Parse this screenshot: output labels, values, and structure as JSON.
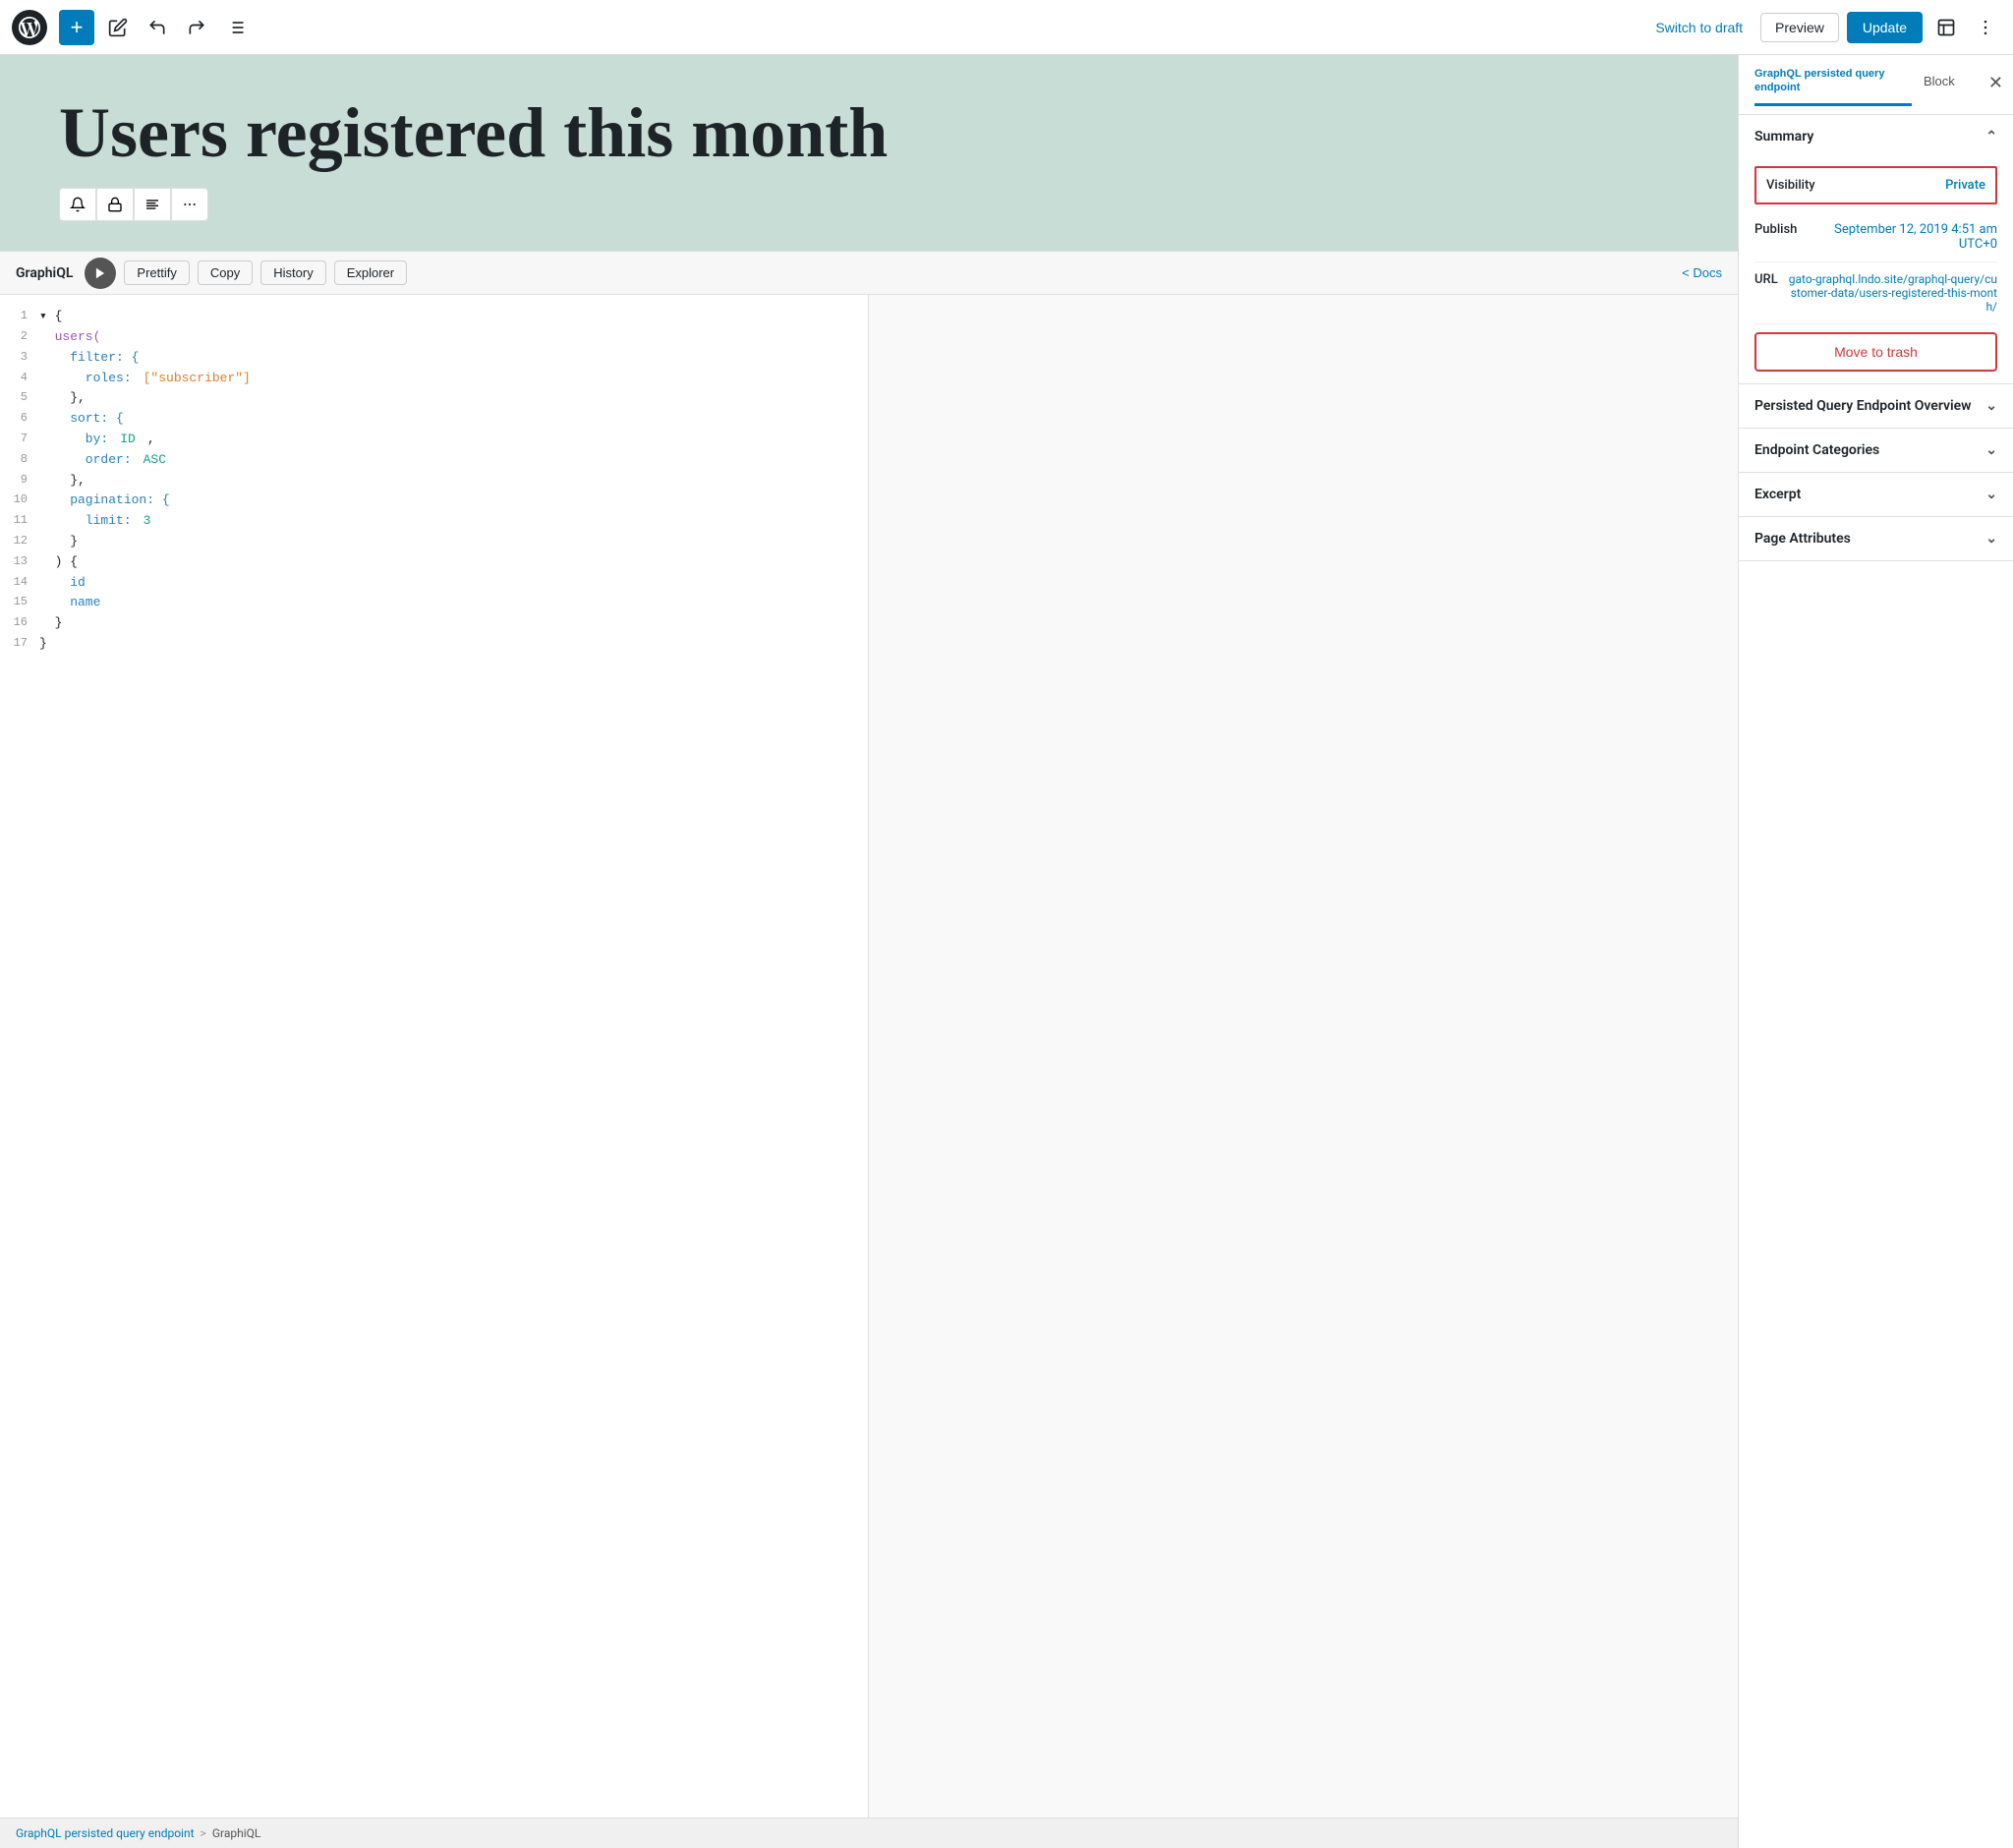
{
  "toolbar": {
    "plus_label": "+",
    "switch_to_draft_label": "Switch to draft",
    "preview_label": "Preview",
    "update_label": "Update"
  },
  "hero": {
    "title": "Users registered this month"
  },
  "graphiql": {
    "title": "GraphiQL",
    "prettify_label": "Prettify",
    "copy_label": "Copy",
    "history_label": "History",
    "explorer_label": "Explorer",
    "docs_label": "< Docs",
    "code_lines": [
      {
        "num": "1",
        "tokens": [
          {
            "text": "{",
            "cls": "plain"
          }
        ]
      },
      {
        "num": "2",
        "tokens": [
          {
            "text": "  users(",
            "cls": "kw-purple"
          }
        ]
      },
      {
        "num": "3",
        "tokens": [
          {
            "text": "    filter: {",
            "cls": "kw-blue"
          }
        ]
      },
      {
        "num": "4",
        "tokens": [
          {
            "text": "      roles: ",
            "cls": "kw-blue"
          },
          {
            "text": "[\"subscriber\"]",
            "cls": "str-orange"
          }
        ]
      },
      {
        "num": "5",
        "tokens": [
          {
            "text": "    },",
            "cls": "plain"
          }
        ]
      },
      {
        "num": "6",
        "tokens": [
          {
            "text": "    sort: {",
            "cls": "kw-blue"
          }
        ]
      },
      {
        "num": "7",
        "tokens": [
          {
            "text": "      by: ",
            "cls": "kw-blue"
          },
          {
            "text": "ID",
            "cls": "kw-teal"
          },
          {
            "text": ",",
            "cls": "plain"
          }
        ]
      },
      {
        "num": "8",
        "tokens": [
          {
            "text": "      order: ",
            "cls": "kw-blue"
          },
          {
            "text": "ASC",
            "cls": "kw-teal"
          }
        ]
      },
      {
        "num": "9",
        "tokens": [
          {
            "text": "    },",
            "cls": "plain"
          }
        ]
      },
      {
        "num": "10",
        "tokens": [
          {
            "text": "    pagination: {",
            "cls": "kw-blue"
          }
        ]
      },
      {
        "num": "11",
        "tokens": [
          {
            "text": "      limit: ",
            "cls": "kw-blue"
          },
          {
            "text": "3",
            "cls": "kw-teal"
          }
        ]
      },
      {
        "num": "12",
        "tokens": [
          {
            "text": "    }",
            "cls": "plain"
          }
        ]
      },
      {
        "num": "13",
        "tokens": [
          {
            "text": "  ) {",
            "cls": "plain"
          }
        ]
      },
      {
        "num": "14",
        "tokens": [
          {
            "text": "    id",
            "cls": "kw-blue"
          }
        ]
      },
      {
        "num": "15",
        "tokens": [
          {
            "text": "    name",
            "cls": "kw-blue"
          }
        ]
      },
      {
        "num": "16",
        "tokens": [
          {
            "text": "  }",
            "cls": "plain"
          }
        ]
      },
      {
        "num": "17",
        "tokens": [
          {
            "text": "}",
            "cls": "plain"
          }
        ]
      }
    ]
  },
  "status_bar": {
    "breadcrumb_root": "GraphQL persisted query endpoint",
    "separator": ">",
    "breadcrumb_current": "GraphiQL"
  },
  "sidebar": {
    "tab_document_title": "GraphQL persisted query endpoint",
    "tab_block_label": "Block",
    "summary_label": "Summary",
    "visibility_label": "Visibility",
    "visibility_value": "Private",
    "publish_label": "Publish",
    "publish_value": "September 12, 2019 4:51 am UTC+0",
    "url_label": "URL",
    "url_value": "gato-graphql.lndo.site/graphql-query/customer-data/users-registered-this-month/",
    "move_to_trash_label": "Move to trash",
    "persisted_query_overview_label": "Persisted Query Endpoint Overview",
    "endpoint_categories_label": "Endpoint Categories",
    "excerpt_label": "Excerpt",
    "page_attributes_label": "Page Attributes"
  }
}
